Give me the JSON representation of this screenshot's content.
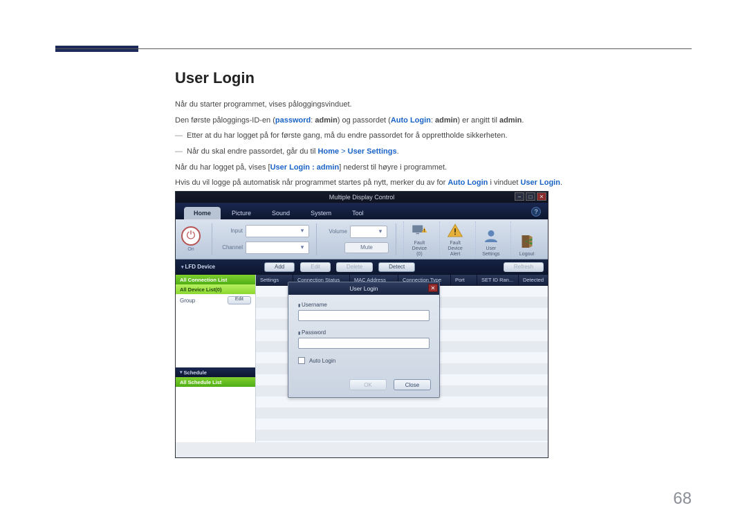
{
  "page": {
    "title": "User Login",
    "page_number": "68",
    "p1": "Når du starter programmet, vises påloggingsvinduet.",
    "p2a": "Den første påloggings-ID-en (",
    "p2b": "password",
    "p2c": ": ",
    "p2d": "admin",
    "p2e": ") og passordet (",
    "p2f": "Auto Login",
    "p2g": ": ",
    "p2h": "admin",
    "p2i": ") er angitt til ",
    "p2j": "admin",
    "p2k": ".",
    "d1": "Etter at du har logget på for første gang, må du endre passordet for å opprettholde sikkerheten.",
    "d2a": "Når du skal endre passordet, går du til ",
    "d2b": "Home",
    "d2c": " > ",
    "d2d": "User Settings",
    "d2e": ".",
    "p3a": "Når du har logget på, vises [",
    "p3b": "User Login : admin",
    "p3c": "] nederst til høyre i programmet.",
    "p4a": "Hvis du vil logge på automatisk når programmet startes på nytt, merker du av for ",
    "p4b": "Auto Login",
    "p4c": " i vinduet ",
    "p4d": "User Login",
    "p4e": "."
  },
  "app": {
    "title": "Multiple Display Control",
    "tabs": {
      "home": "Home",
      "picture": "Picture",
      "sound": "Sound",
      "system": "System",
      "tool": "Tool"
    },
    "help": "?",
    "power_label": "On",
    "ribbon": {
      "input": "Input",
      "channel": "Channel",
      "volume": "Volume",
      "mute": "Mute",
      "fault_device": "Fault Device\n(0)",
      "fault_alert": "Fault Device\nAlert",
      "user_settings": "User Settings",
      "logout": "Logout"
    },
    "toolbar2": {
      "lfd": "LFD Device",
      "add": "Add",
      "edit": "Edit",
      "delete": "Delete",
      "detect": "Detect",
      "refresh": "Refresh"
    },
    "nav": {
      "all_conn": "All Connection List",
      "all_dev": "All Device List(0)",
      "group": "Group",
      "group_edit": "Edit",
      "schedule": "Schedule",
      "all_schedule": "All Schedule List"
    },
    "table": {
      "settings": "Settings",
      "conn": "Connection Status",
      "mac": "MAC Address",
      "ctype": "Connection Type",
      "port": "Port",
      "setid": "SET ID Ran...",
      "detected": "Detected"
    },
    "dialog": {
      "title": "User Login",
      "username": "Username",
      "password": "Password",
      "auto": "Auto Login",
      "ok": "OK",
      "close": "Close"
    }
  }
}
